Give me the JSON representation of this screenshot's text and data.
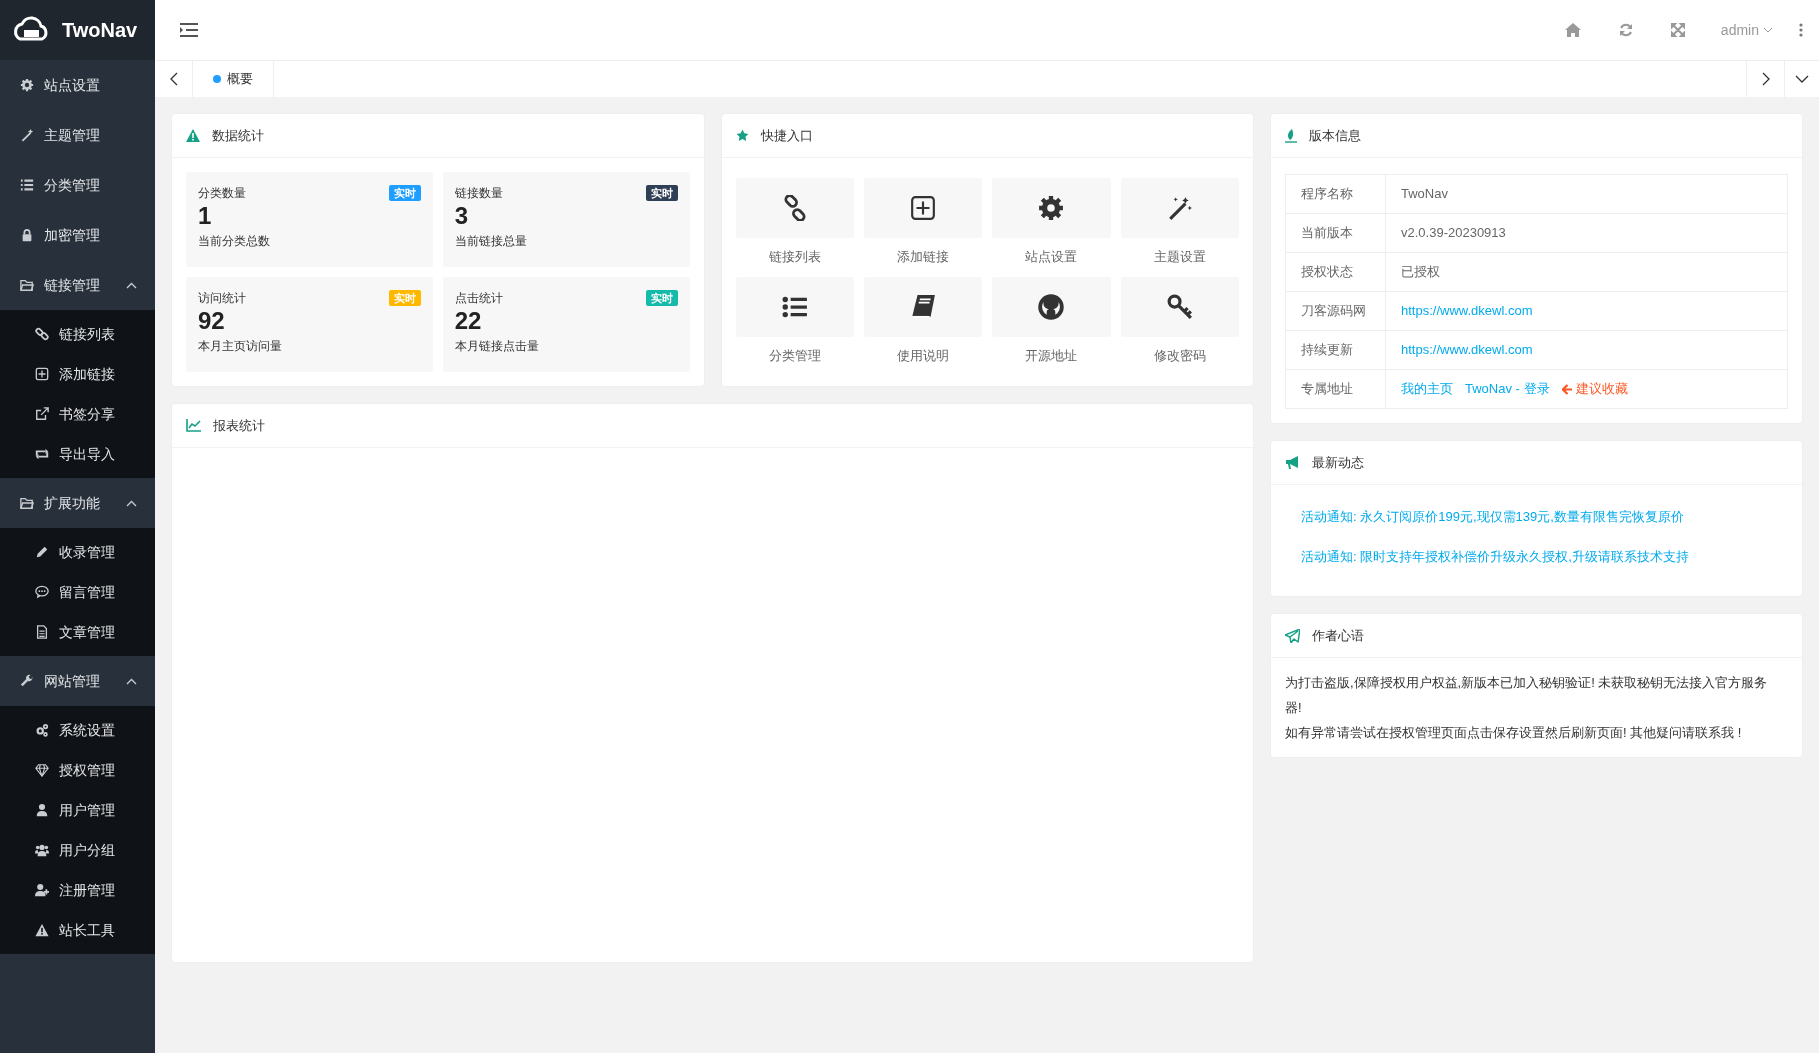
{
  "sidebar": {
    "logo": "TwoNav",
    "items": [
      {
        "kind": "item",
        "label": "站点设置"
      },
      {
        "kind": "item",
        "label": "主题管理"
      },
      {
        "kind": "item",
        "label": "分类管理"
      },
      {
        "kind": "item",
        "label": "加密管理"
      },
      {
        "kind": "group",
        "label": "链接管理",
        "expanded": true,
        "children": [
          {
            "label": "链接列表"
          },
          {
            "label": "添加链接"
          },
          {
            "label": "书签分享"
          },
          {
            "label": "导出导入"
          }
        ]
      },
      {
        "kind": "group",
        "label": "扩展功能",
        "expanded": true,
        "children": [
          {
            "label": "收录管理"
          },
          {
            "label": "留言管理"
          },
          {
            "label": "文章管理"
          }
        ]
      },
      {
        "kind": "group",
        "label": "网站管理",
        "expanded": true,
        "children": [
          {
            "label": "系统设置"
          },
          {
            "label": "授权管理"
          },
          {
            "label": "用户管理"
          },
          {
            "label": "用户分组"
          },
          {
            "label": "注册管理"
          },
          {
            "label": "站长工具"
          }
        ]
      }
    ]
  },
  "header": {
    "user": "admin"
  },
  "tabs": [
    {
      "label": "概要",
      "selected": true
    }
  ],
  "stats": {
    "title": "数据统计",
    "cards": [
      {
        "label": "分类数量",
        "badge": "实时",
        "color": "#1e9fff",
        "value": "1",
        "desc": "当前分类总数"
      },
      {
        "label": "链接数量",
        "badge": "实时",
        "color": "#2f4056",
        "value": "3",
        "desc": "当前链接总量"
      },
      {
        "label": "访问统计",
        "badge": "实时",
        "color": "#ffb800",
        "value": "92",
        "desc": "本月主页访问量"
      },
      {
        "label": "点击统计",
        "badge": "实时",
        "color": "#16baaa",
        "value": "22",
        "desc": "本月链接点击量"
      }
    ]
  },
  "quick": {
    "title": "快捷入口",
    "items": [
      {
        "label": "链接列表"
      },
      {
        "label": "添加链接"
      },
      {
        "label": "站点设置"
      },
      {
        "label": "主题设置"
      },
      {
        "label": "分类管理"
      },
      {
        "label": "使用说明"
      },
      {
        "label": "开源地址"
      },
      {
        "label": "修改密码"
      }
    ]
  },
  "report": {
    "title": "报表统计"
  },
  "version": {
    "title": "版本信息",
    "rows": [
      {
        "label": "程序名称",
        "parts": [
          {
            "kind": "text",
            "text": "TwoNav"
          }
        ]
      },
      {
        "label": "当前版本",
        "parts": [
          {
            "kind": "text",
            "text": "v2.0.39-20230913"
          }
        ]
      },
      {
        "label": "授权状态",
        "parts": [
          {
            "kind": "text",
            "text": "已授权"
          }
        ]
      },
      {
        "label": "刀客源码网",
        "parts": [
          {
            "kind": "link",
            "text": "https://www.dkewl.com"
          }
        ]
      },
      {
        "label": "持续更新",
        "parts": [
          {
            "kind": "link",
            "text": "https://www.dkewl.com"
          }
        ]
      },
      {
        "label": "专属地址",
        "parts": [
          {
            "kind": "link",
            "text": "我的主页"
          },
          {
            "kind": "link",
            "text": "TwoNav - 登录"
          },
          {
            "kind": "hint",
            "text": "建议收藏"
          }
        ]
      }
    ]
  },
  "news": {
    "title": "最新动态",
    "items": [
      "活动通知: 永久订阅原价199元,现仅需139元,数量有限售完恢复原价",
      "活动通知: 限时支持年授权补偿价升级永久授权,升级请联系技术支持"
    ]
  },
  "author": {
    "title": "作者心语",
    "paragraphs": [
      "为打击盗版,保障授权用户权益,新版本已加入秘钥验证! 未获取秘钥无法接入官方服务器!",
      "如有异常请尝试在授权管理页面点击保存设置然后刷新页面! 其他疑问请联系我 !"
    ]
  }
}
